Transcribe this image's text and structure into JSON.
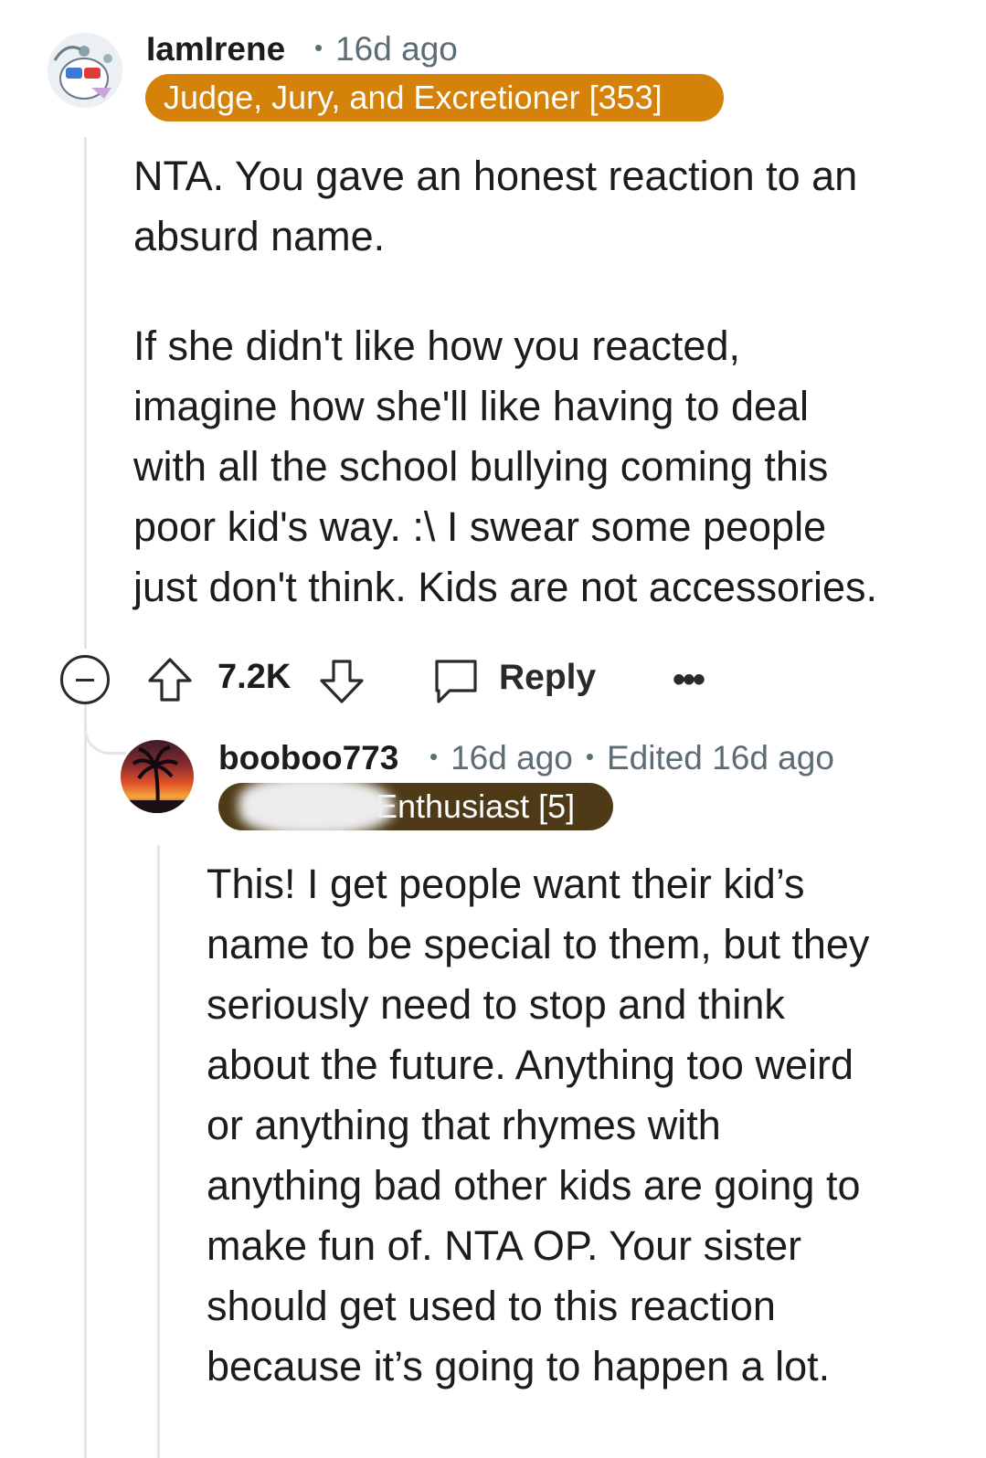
{
  "comment": {
    "username": "IamIrene",
    "time": "16d ago",
    "flair": "Judge, Jury, and Excretioner [353]",
    "flair_color": "#d4820a",
    "paragraphs": [
      "NTA. You gave an honest reaction to an\nabsurd name.",
      "If she didn't like how you reacted,\nimagine how she'll like having to deal\nwith all the school bullying coming this\npoor kid's way. :\\ I swear some people\njust don't think. Kids are not accessories."
    ],
    "actions": {
      "collapse_icon": "collapse-icon",
      "upvote_icon": "upvote-arrow-icon",
      "vote_count": "7.2K",
      "downvote_icon": "downvote-arrow-icon",
      "reply_icon": "speech-bubble-icon",
      "reply_label": "Reply",
      "more_label": "•••"
    }
  },
  "reply": {
    "username": "booboo773",
    "time": "16d ago",
    "edited": "Edited 16d ago",
    "flair": "Enthusiast [5]",
    "flair_color": "#4e3a16",
    "paragraphs": [
      "This! I get people want their kid’s\nname to be special to them, but they\nseriously need to stop and think\nabout the future. Anything too weird\nor anything that rhymes with\nanything bad other kids are going to\nmake fun of. NTA OP. Your sister\nshould get used to this reaction\nbecause it’s going to happen a lot."
    ]
  }
}
